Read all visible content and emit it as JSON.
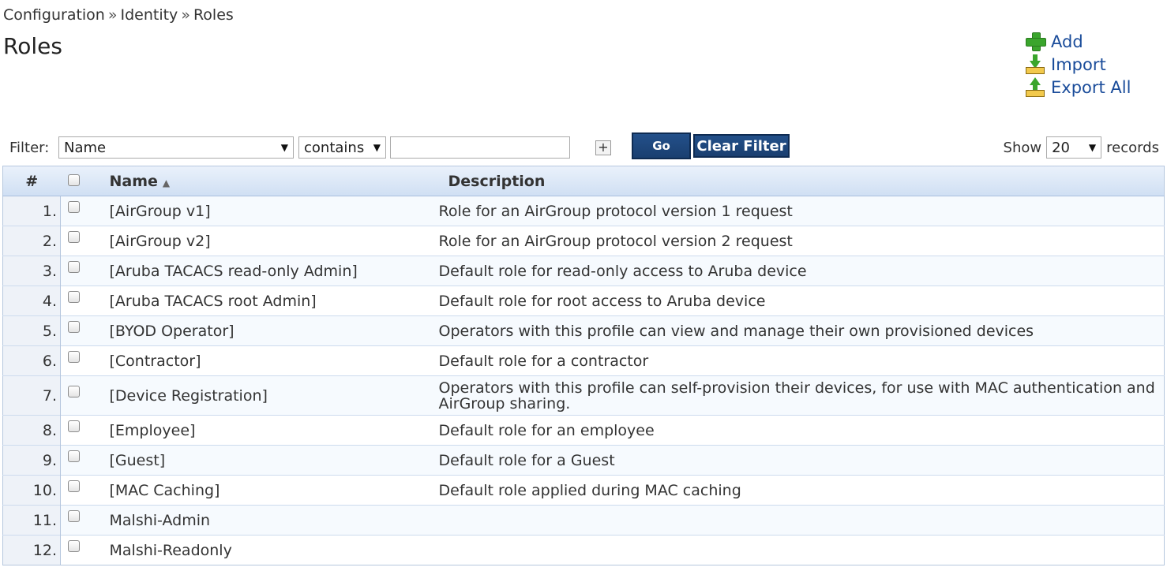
{
  "breadcrumb": [
    "Configuration",
    "Identity",
    "Roles"
  ],
  "breadcrumb_sep": "»",
  "page_title": "Roles",
  "actions": {
    "add": "Add",
    "import": "Import",
    "export_all": "Export All"
  },
  "filter": {
    "label": "Filter:",
    "field_value": "Name",
    "operator_value": "contains",
    "search_value": "",
    "add_condition": "+",
    "go_label": "Go",
    "clear_label": "Clear Filter",
    "show_label": "Show",
    "page_size": "20",
    "records_label": "records"
  },
  "table": {
    "columns": {
      "num": "#",
      "name": "Name",
      "description": "Description"
    },
    "sort_indicator": "▲",
    "rows": [
      {
        "num": "1.",
        "name": "[AirGroup v1]",
        "description": "Role for an AirGroup protocol version 1 request"
      },
      {
        "num": "2.",
        "name": "[AirGroup v2]",
        "description": "Role for an AirGroup protocol version 2 request"
      },
      {
        "num": "3.",
        "name": "[Aruba TACACS read-only Admin]",
        "description": "Default role for read-only access to Aruba device"
      },
      {
        "num": "4.",
        "name": "[Aruba TACACS root Admin]",
        "description": "Default role for root access to Aruba device"
      },
      {
        "num": "5.",
        "name": "[BYOD Operator]",
        "description": "Operators with this profile can view and manage their own provisioned devices"
      },
      {
        "num": "6.",
        "name": "[Contractor]",
        "description": "Default role for a contractor"
      },
      {
        "num": "7.",
        "name": "[Device Registration]",
        "description": "Operators with this profile can self-provision their devices, for use with MAC authentication and AirGroup sharing."
      },
      {
        "num": "8.",
        "name": "[Employee]",
        "description": "Default role for an employee"
      },
      {
        "num": "9.",
        "name": "[Guest]",
        "description": "Default role for a Guest"
      },
      {
        "num": "10.",
        "name": "[MAC Caching]",
        "description": "Default role applied during MAC caching"
      },
      {
        "num": "11.",
        "name": "Malshi-Admin",
        "description": ""
      },
      {
        "num": "12.",
        "name": "Malshi-Readonly",
        "description": ""
      }
    ]
  },
  "colors": {
    "link": "#1a4c9a",
    "button": "#1f4a80",
    "header_gradient_top": "#eaf1fb",
    "header_gradient_bottom": "#cfdff3"
  }
}
